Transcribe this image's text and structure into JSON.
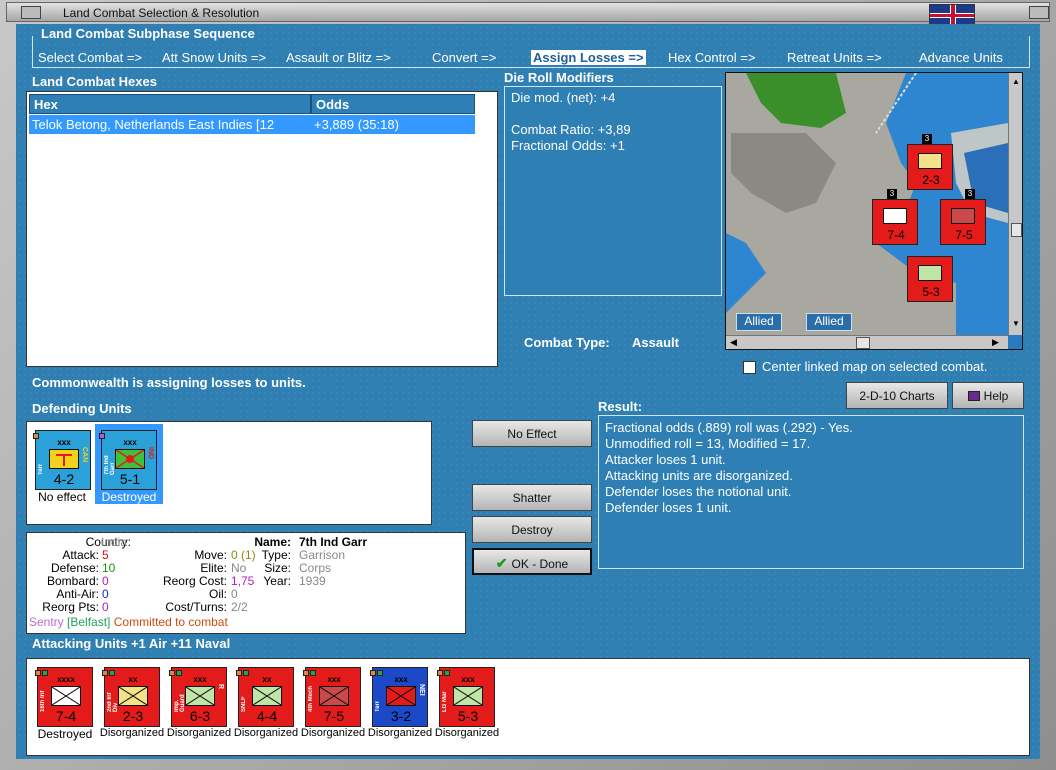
{
  "window": {
    "title": "Land Combat Selection & Resolution"
  },
  "sequence": {
    "legend": "Land Combat Subphase Sequence",
    "steps": [
      "Select Combat =>",
      "Att Snow Units =>",
      "Assault or Blitz =>",
      "Convert =>",
      "Assign Losses =>",
      "Hex Control =>",
      "Retreat Units =>",
      "Advance Units"
    ],
    "active": 4
  },
  "hexes": {
    "label": "Land Combat Hexes",
    "col_hex": "Hex",
    "col_odds": "Odds",
    "rows": [
      {
        "hex": "Telok Betong, Netherlands East Indies [12",
        "odds": "+3,889 (35:18)"
      }
    ]
  },
  "drm": {
    "label": "Die Roll Modifiers",
    "lines": [
      "Die mod. (net): +4",
      "",
      "Combat Ratio: +3,89",
      "Fractional Odds: +1"
    ]
  },
  "combat_type": {
    "label": "Combat Type:",
    "value": "Assault"
  },
  "map": {
    "tag1": "Allied",
    "tag2": "Allied",
    "checkbox_label": "Center linked map on selected combat."
  },
  "status_msg": "Commonwealth is assigning losses to units.",
  "defending": {
    "label": "Defending Units",
    "units": [
      {
        "size": "xxx",
        "value": "4-2",
        "name": "Terr",
        "nat": "CAN",
        "status": "No effect",
        "color": "#2aa1d8",
        "icon": "#f2d21b",
        "icon_name": "territorial-icon"
      },
      {
        "size": "xxx",
        "value": "5-1",
        "name": "7th Ind Garr",
        "nat": "IND",
        "status": "Destroyed",
        "color": "#2aa1d8",
        "icon": "#3ec23e",
        "icon_name": "garrison-icon"
      }
    ]
  },
  "buttons": {
    "no_effect": "No Effect",
    "shatter": "Shatter",
    "destroy": "Destroy",
    "ok": "OK - Done",
    "charts": "2-D-10 Charts",
    "help": "Help"
  },
  "result": {
    "label": "Result:",
    "lines": [
      "Fractional odds (.889) roll was (.292)  - Yes.",
      "Unmodified roll = 13, Modified = 17.",
      "Attacker loses 1 unit.",
      "Attacking units are disorganized.",
      "Defender loses the notional unit.",
      "Defender loses 1 unit."
    ]
  },
  "details": {
    "country_k": "Country:",
    "country_v": "India",
    "attack_k": "Attack:",
    "attack_v": "5",
    "defense_k": "Defense:",
    "defense_v": "10",
    "bombard_k": "Bombard:",
    "bombard_v": "0",
    "antiair_k": "Anti-Air:",
    "antiair_v": "0",
    "reorgpts_k": "Reorg Pts:",
    "reorgpts_v": "0",
    "move_k": "Move:",
    "move_v": "0 (1)",
    "elite_k": "Elite:",
    "elite_v": "No",
    "reorgcost_k": "Reorg Cost:",
    "reorgcost_v": "1,75",
    "oil_k": "Oil:",
    "oil_v": "0",
    "costturns_k": "Cost/Turns:",
    "costturns_v": "2/2",
    "name_k": "Name:",
    "name_v": "7th Ind Garr",
    "type_k": "Type:",
    "type_v": "Garrison",
    "size_k": "Size:",
    "size_v": "Corps",
    "year_k": "Year:",
    "year_v": "1939",
    "sentry": "Sentry",
    "belfast": "[Belfast]",
    "committed": "Committed to combat"
  },
  "attacking": {
    "label": "Attacking Units +1 Air +11 Naval",
    "units": [
      {
        "size": "xxxx",
        "value": "7-4",
        "name": "16th Inf",
        "nat": "",
        "status": "Destroyed",
        "color": "#e41b1b",
        "icon": "#ffffff"
      },
      {
        "size": "xx",
        "value": "2-3",
        "name": "2nd Inf Div",
        "nat": "",
        "status": "Disorganized",
        "color": "#e41b1b",
        "icon": "#f2e28a"
      },
      {
        "size": "xxx",
        "value": "6-3",
        "name": "Imp. Guard",
        "nat": "R",
        "status": "Disorganized",
        "color": "#e41b1b",
        "icon": "#bfe6a8"
      },
      {
        "size": "xx",
        "value": "4-4",
        "name": "SNLF",
        "nat": "",
        "status": "Disorganized",
        "color": "#e41b1b",
        "icon": "#bfe6a8"
      },
      {
        "size": "xxx",
        "value": "7-5",
        "name": "4th Mech",
        "nat": "",
        "status": "Disorganized",
        "color": "#e41b1b",
        "icon": "#c84a4a"
      },
      {
        "size": "xxx",
        "value": "3-2",
        "name": "Terr",
        "nat": "NEI",
        "status": "Disorganized",
        "color": "#1b49c8",
        "icon": "#e41b1b"
      },
      {
        "size": "xxx",
        "value": "5-3",
        "name": "LG Mar",
        "nat": "",
        "status": "Disorganized",
        "color": "#e41b1b",
        "icon": "#bfe6a8"
      }
    ]
  },
  "map_units": [
    {
      "value": "2-3",
      "size": "xx",
      "stack": "3"
    },
    {
      "value": "7-4",
      "size": "xxx",
      "stack": "3"
    },
    {
      "value": "7-5",
      "size": "xxx",
      "stack": "3"
    },
    {
      "value": "5-3",
      "size": "xxx",
      "stack": ""
    }
  ]
}
